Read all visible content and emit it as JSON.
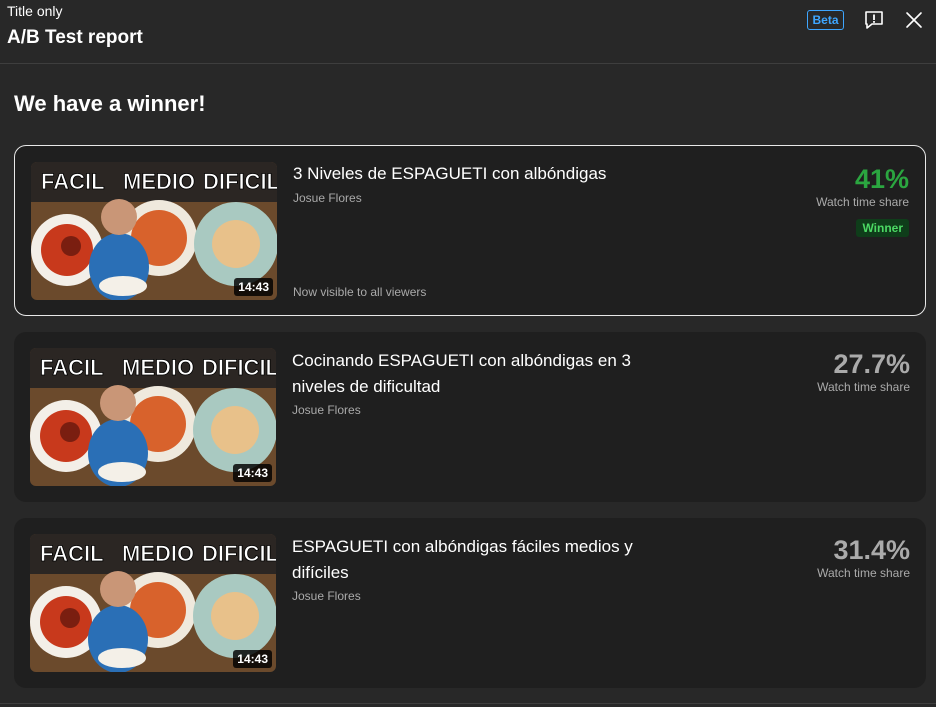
{
  "header": {
    "subtitle": "Title only",
    "title": "A/B Test report",
    "beta_label": "Beta",
    "feedback_icon": "feedback-icon",
    "close_icon": "close-icon"
  },
  "headline": "We have a winner!",
  "thumbnail": {
    "overlay_words": [
      "FACIL",
      "MEDIO",
      "DIFICIL"
    ]
  },
  "variants": [
    {
      "title": "3 Niveles de ESPAGUETI con albóndigas",
      "channel": "Josue Flores",
      "duration": "14:43",
      "percent": "41%",
      "metric_label": "Watch time share",
      "badge": "Winner",
      "note": "Now visible to all viewers",
      "color": "#2ba640"
    },
    {
      "title": "Cocinando ESPAGUETI con albóndigas en 3 niveles de dificultad",
      "channel": "Josue Flores",
      "duration": "14:43",
      "percent": "27.7%",
      "metric_label": "Watch time share",
      "color": "#aaaaaa"
    },
    {
      "title": "ESPAGUETI con albóndigas fáciles medios y difíciles",
      "channel": "Josue Flores",
      "duration": "14:43",
      "percent": "31.4%",
      "metric_label": "Watch time share",
      "color": "#aaaaaa"
    }
  ]
}
